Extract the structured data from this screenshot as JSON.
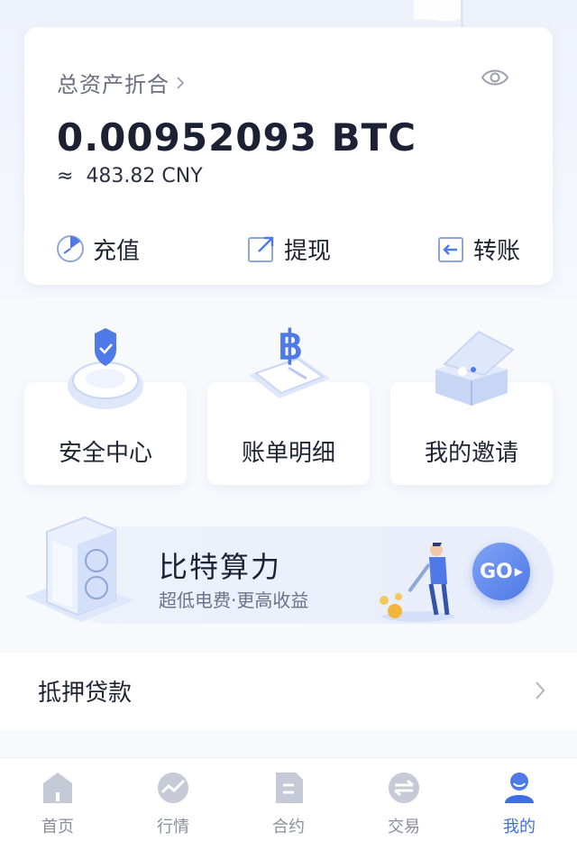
{
  "asset": {
    "label": "总资产折合",
    "btc_amount": "0.00952093 BTC",
    "approx_symbol": "≈",
    "cny_amount": "483.82 CNY"
  },
  "actions": [
    {
      "label": "充值",
      "icon": "deposit-icon"
    },
    {
      "label": "提现",
      "icon": "withdraw-icon"
    },
    {
      "label": "转账",
      "icon": "transfer-icon"
    }
  ],
  "features": [
    {
      "label": "安全中心",
      "icon": "shield-icon"
    },
    {
      "label": "账单明细",
      "icon": "bitcoin-phone-icon"
    },
    {
      "label": "我的邀请",
      "icon": "gift-box-icon"
    }
  ],
  "banner": {
    "title": "比特算力",
    "subtitle": "超低电费·更高收益",
    "go_label": "GO"
  },
  "loan": {
    "label": "抵押贷款"
  },
  "tabs": [
    {
      "label": "首页",
      "icon": "home-icon",
      "active": false
    },
    {
      "label": "行情",
      "icon": "chart-icon",
      "active": false
    },
    {
      "label": "合约",
      "icon": "contract-icon",
      "active": false
    },
    {
      "label": "交易",
      "icon": "exchange-icon",
      "active": false
    },
    {
      "label": "我的",
      "icon": "user-icon",
      "active": true
    }
  ],
  "colors": {
    "accent": "#3f6ee6",
    "tab_inactive": "#8a8f9c",
    "background": "#f7f9fd"
  }
}
